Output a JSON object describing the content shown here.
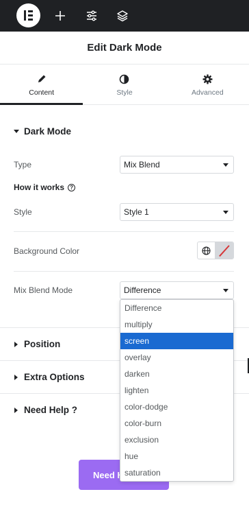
{
  "header": {
    "title": "Edit Dark Mode"
  },
  "tabs": [
    {
      "label": "Content",
      "icon": "pencil-icon",
      "active": true
    },
    {
      "label": "Style",
      "icon": "half-circle-icon",
      "active": false
    },
    {
      "label": "Advanced",
      "icon": "gear-icon",
      "active": false
    }
  ],
  "dark_mode": {
    "title": "Dark Mode",
    "type_label": "Type",
    "type_value": "Mix Blend",
    "how_it_works": "How it works",
    "style_label": "Style",
    "style_value": "Style 1",
    "bg_color_label": "Background Color",
    "mix_blend_label": "Mix Blend Mode",
    "mix_blend_value": "Difference",
    "mix_blend_options": [
      "Difference",
      "multiply",
      "screen",
      "overlay",
      "darken",
      "lighten",
      "color-dodge",
      "color-burn",
      "exclusion",
      "hue",
      "saturation"
    ],
    "highlighted_option": "screen"
  },
  "sections": {
    "position": "Position",
    "extra_options": "Extra Options",
    "need_help": "Need Help ?"
  },
  "need_help_button": {
    "label": "Need Help"
  },
  "colors": {
    "topbar": "#1f2124",
    "highlight": "#1a6ad1",
    "button": "#9b6bf2",
    "no_color_slash": "#d63638"
  }
}
